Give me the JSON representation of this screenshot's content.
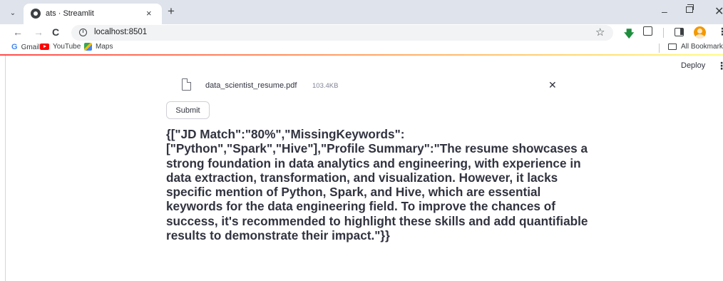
{
  "browser": {
    "tab": {
      "title": "ats · Streamlit",
      "close_glyph": "×",
      "favicon": "streamlit-icon"
    },
    "new_tab_glyph": "+",
    "window_controls": {
      "minimize": "–",
      "close": "✕"
    },
    "nav": {
      "back": "←",
      "forward": "→",
      "reload": "C"
    },
    "address": {
      "url": "localhost:8501",
      "info_glyph": "i"
    },
    "toolbar_icons": {
      "star": "☆",
      "download": "🡇",
      "menu": "⋮"
    },
    "bookmarks": [
      {
        "label": "Gmail",
        "icon": "gmail-icon"
      },
      {
        "label": "YouTube",
        "icon": "youtube-icon"
      },
      {
        "label": "Maps",
        "icon": "maps-icon"
      }
    ],
    "all_bookmarks": "All Bookmarks"
  },
  "app": {
    "deploy_label": "Deploy",
    "menu_glyph": "⋮",
    "uploaded_file": {
      "name": "data_scientist_resume.pdf",
      "size": "103.4KB",
      "remove_glyph": "✕"
    },
    "submit_label": "Submit",
    "response": "{[\"JD Match\":\"80%\",\"MissingKeywords\":[\"Python\",\"Spark\",\"Hive\"],\"Profile Summary\":\"The resume showcases a strong foundation in data analytics and engineering, with experience in data extraction, transformation, and visualization. However, it lacks specific mention of Python, Spark, and Hive, which are essential keywords for the data engineering field. To improve the chances of success, it's recommended to highlight these skills and add quantifiable results to demonstrate their impact.\"}}"
  },
  "colors": {
    "streamlit_red": "#ff4b4b",
    "text": "#31333f",
    "chrome_frame": "#dfe3eb"
  }
}
